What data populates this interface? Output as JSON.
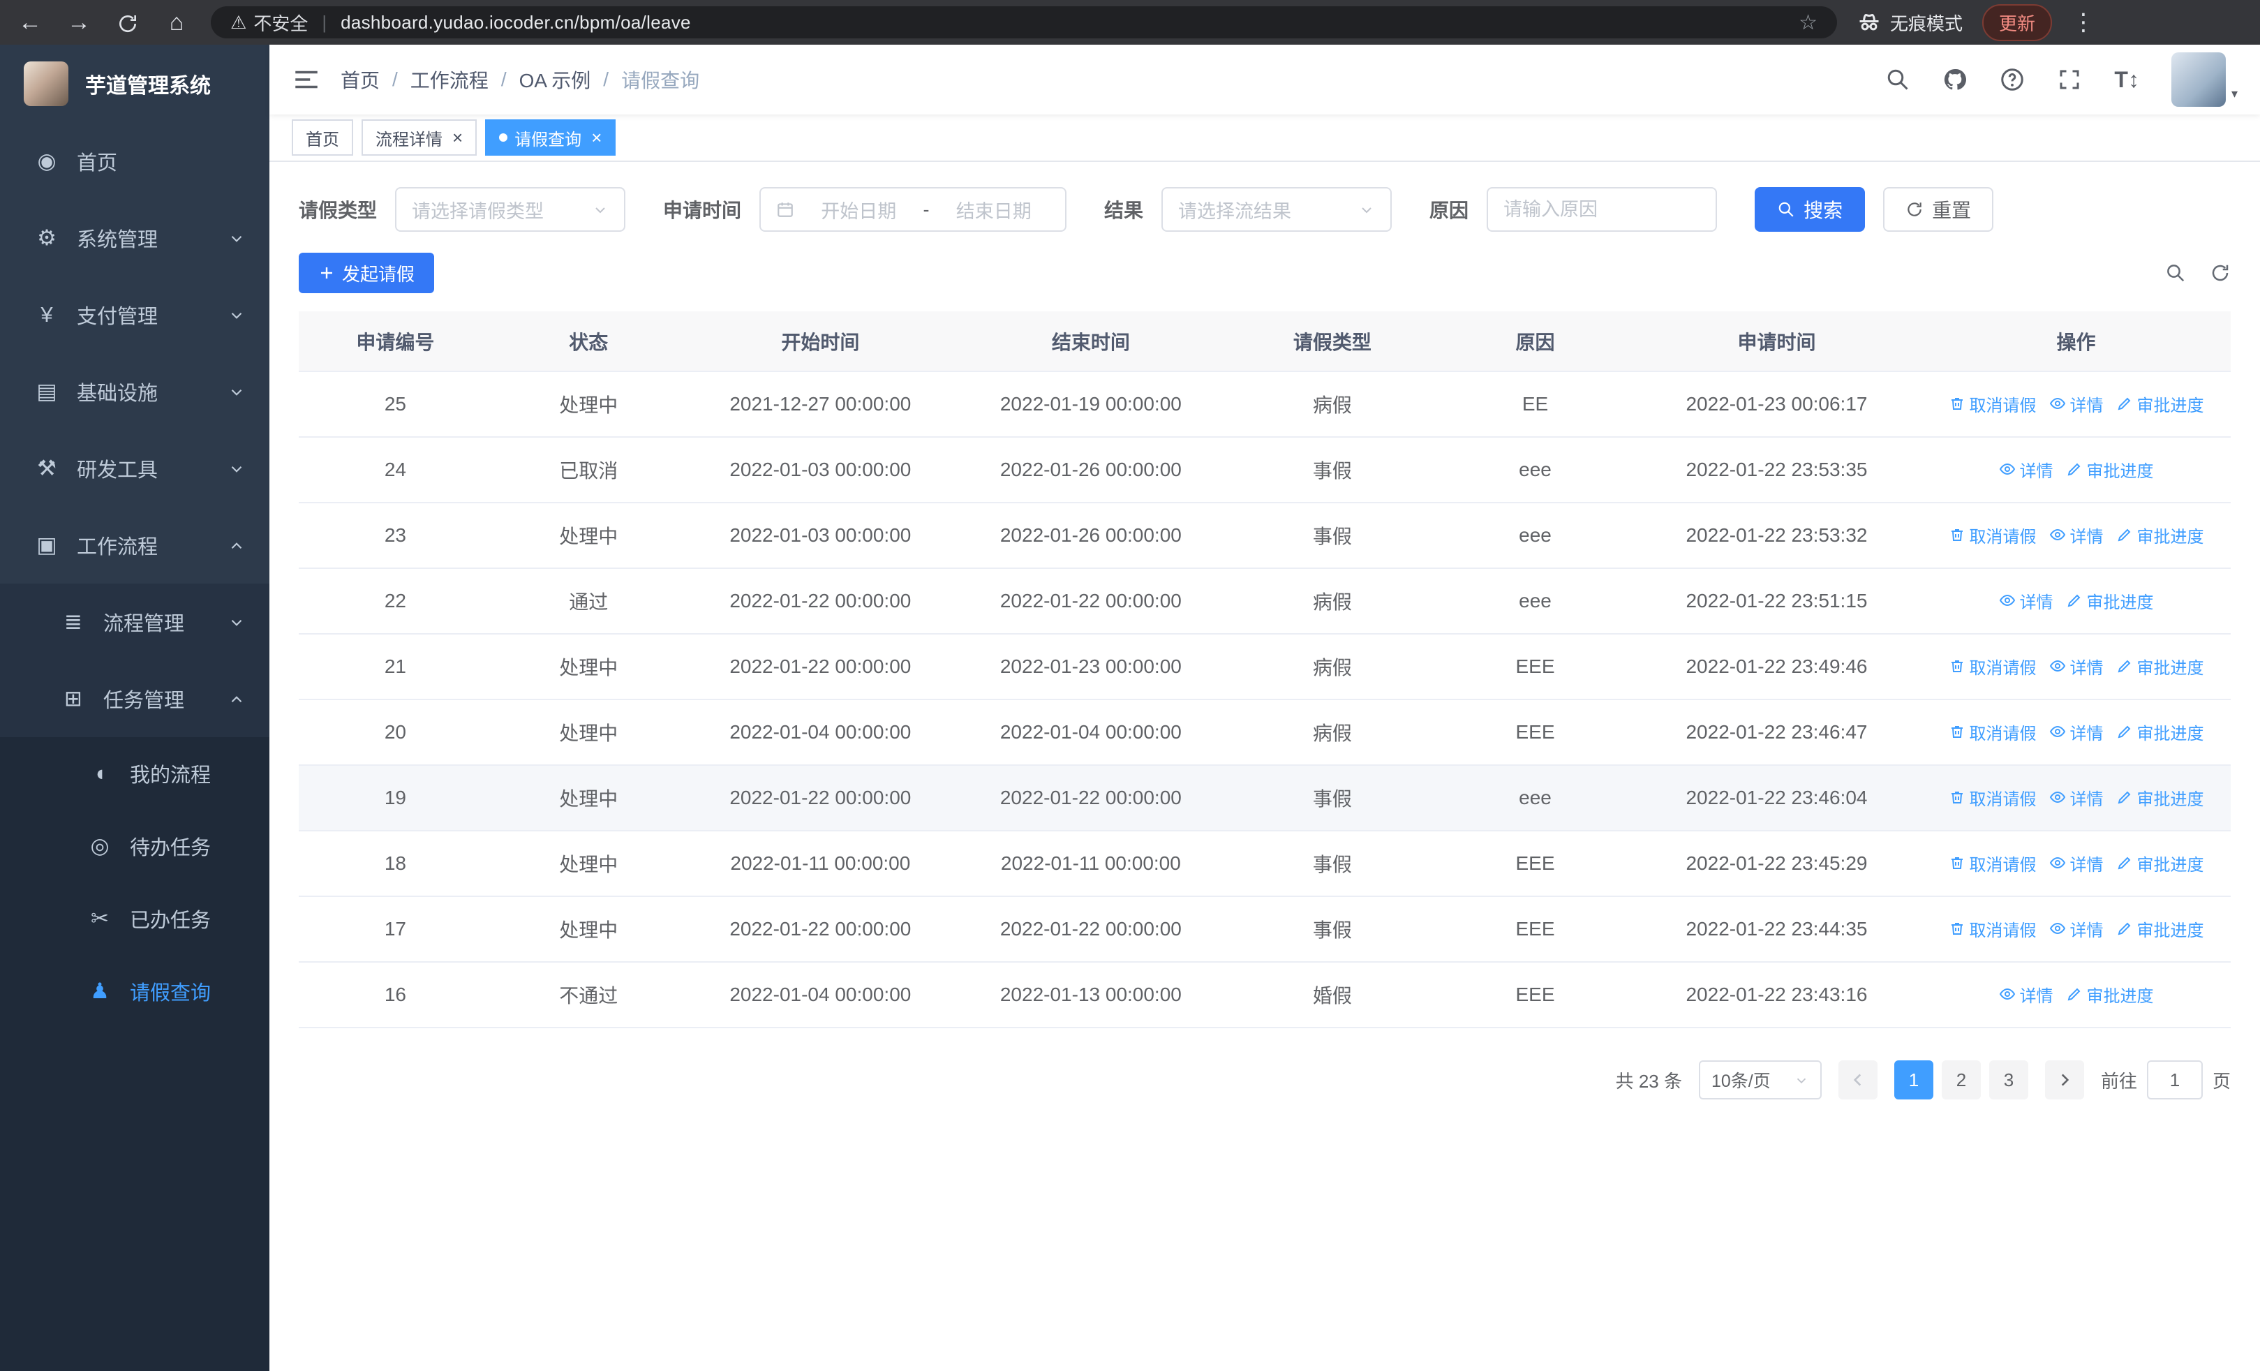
{
  "browser": {
    "warning": "不安全",
    "url": "dashboard.yudao.iocoder.cn/bpm/oa/leave",
    "incognito_label": "无痕模式",
    "update_label": "更新"
  },
  "sidebar": {
    "logo_title": "芋道管理系统",
    "items": [
      {
        "key": "home",
        "label": "首页",
        "icon": "dashboard-icon",
        "level": 1,
        "chevron": null,
        "active": false
      },
      {
        "key": "system-mgmt",
        "label": "系统管理",
        "icon": "gear-icon",
        "level": 1,
        "chevron": "down",
        "active": false
      },
      {
        "key": "payment-mgmt",
        "label": "支付管理",
        "icon": "yen-icon",
        "level": 1,
        "chevron": "down",
        "active": false
      },
      {
        "key": "infrastructure",
        "label": "基础设施",
        "icon": "infra-icon",
        "level": 1,
        "chevron": "down",
        "active": false
      },
      {
        "key": "dev-tools",
        "label": "研发工具",
        "icon": "tools-icon",
        "level": 1,
        "chevron": "down",
        "active": false
      },
      {
        "key": "workflow",
        "label": "工作流程",
        "icon": "workflow-icon",
        "level": 1,
        "chevron": "up",
        "active": false
      },
      {
        "key": "process-mgmt",
        "label": "流程管理",
        "icon": "process-icon",
        "level": 2,
        "chevron": "down",
        "active": false
      },
      {
        "key": "task-mgmt",
        "label": "任务管理",
        "icon": "task-icon",
        "level": 2,
        "chevron": "up",
        "active": false
      },
      {
        "key": "my-process",
        "label": "我的流程",
        "icon": "chat-icon",
        "level": 3,
        "chevron": null,
        "active": false
      },
      {
        "key": "todo-tasks",
        "label": "待办任务",
        "icon": "eye-icon",
        "level": 3,
        "chevron": null,
        "active": false
      },
      {
        "key": "done-tasks",
        "label": "已办任务",
        "icon": "done-icon",
        "level": 3,
        "chevron": null,
        "active": false
      },
      {
        "key": "leave-query",
        "label": "请假查询",
        "icon": "user-icon",
        "level": 3,
        "chevron": null,
        "active": true
      }
    ]
  },
  "header": {
    "breadcrumbs": [
      "首页",
      "工作流程",
      "OA 示例",
      "请假查询"
    ]
  },
  "tabs": [
    {
      "label": "首页",
      "closable": false,
      "active": false
    },
    {
      "label": "流程详情",
      "closable": true,
      "active": false
    },
    {
      "label": "请假查询",
      "closable": true,
      "active": true
    }
  ],
  "filters": {
    "leave_type_label": "请假类型",
    "leave_type_placeholder": "请选择请假类型",
    "apply_time_label": "申请时间",
    "start_date_placeholder": "开始日期",
    "range_separator": "-",
    "end_date_placeholder": "结束日期",
    "result_label": "结果",
    "result_placeholder": "请选择流结果",
    "reason_label": "原因",
    "reason_placeholder": "请输入原因",
    "search_label": "搜索",
    "reset_label": "重置"
  },
  "toolbar": {
    "create_label": "发起请假"
  },
  "table": {
    "columns": [
      "申请编号",
      "状态",
      "开始时间",
      "结束时间",
      "请假类型",
      "原因",
      "申请时间",
      "操作"
    ],
    "action_defs": {
      "cancel": {
        "label": "取消请假",
        "icon": "trash-icon"
      },
      "detail": {
        "label": "详情",
        "icon": "eye-icon"
      },
      "progress": {
        "label": "审批进度",
        "icon": "edit-icon"
      }
    },
    "rows": [
      {
        "id": "25",
        "status": "处理中",
        "start": "2021-12-27 00:00:00",
        "end": "2022-01-19 00:00:00",
        "type": "病假",
        "reason": "EE",
        "apply_time": "2022-01-23 00:06:17",
        "actions": [
          "cancel",
          "detail",
          "progress"
        ],
        "highlighted": false
      },
      {
        "id": "24",
        "status": "已取消",
        "start": "2022-01-03 00:00:00",
        "end": "2022-01-26 00:00:00",
        "type": "事假",
        "reason": "eee",
        "apply_time": "2022-01-22 23:53:35",
        "actions": [
          "detail",
          "progress"
        ],
        "highlighted": false
      },
      {
        "id": "23",
        "status": "处理中",
        "start": "2022-01-03 00:00:00",
        "end": "2022-01-26 00:00:00",
        "type": "事假",
        "reason": "eee",
        "apply_time": "2022-01-22 23:53:32",
        "actions": [
          "cancel",
          "detail",
          "progress"
        ],
        "highlighted": false
      },
      {
        "id": "22",
        "status": "通过",
        "start": "2022-01-22 00:00:00",
        "end": "2022-01-22 00:00:00",
        "type": "病假",
        "reason": "eee",
        "apply_time": "2022-01-22 23:51:15",
        "actions": [
          "detail",
          "progress"
        ],
        "highlighted": false
      },
      {
        "id": "21",
        "status": "处理中",
        "start": "2022-01-22 00:00:00",
        "end": "2022-01-23 00:00:00",
        "type": "病假",
        "reason": "EEE",
        "apply_time": "2022-01-22 23:49:46",
        "actions": [
          "cancel",
          "detail",
          "progress"
        ],
        "highlighted": false
      },
      {
        "id": "20",
        "status": "处理中",
        "start": "2022-01-04 00:00:00",
        "end": "2022-01-04 00:00:00",
        "type": "病假",
        "reason": "EEE",
        "apply_time": "2022-01-22 23:46:47",
        "actions": [
          "cancel",
          "detail",
          "progress"
        ],
        "highlighted": false
      },
      {
        "id": "19",
        "status": "处理中",
        "start": "2022-01-22 00:00:00",
        "end": "2022-01-22 00:00:00",
        "type": "事假",
        "reason": "eee",
        "apply_time": "2022-01-22 23:46:04",
        "actions": [
          "cancel",
          "detail",
          "progress"
        ],
        "highlighted": true
      },
      {
        "id": "18",
        "status": "处理中",
        "start": "2022-01-11 00:00:00",
        "end": "2022-01-11 00:00:00",
        "type": "事假",
        "reason": "EEE",
        "apply_time": "2022-01-22 23:45:29",
        "actions": [
          "cancel",
          "detail",
          "progress"
        ],
        "highlighted": false
      },
      {
        "id": "17",
        "status": "处理中",
        "start": "2022-01-22 00:00:00",
        "end": "2022-01-22 00:00:00",
        "type": "事假",
        "reason": "EEE",
        "apply_time": "2022-01-22 23:44:35",
        "actions": [
          "cancel",
          "detail",
          "progress"
        ],
        "highlighted": false
      },
      {
        "id": "16",
        "status": "不通过",
        "start": "2022-01-04 00:00:00",
        "end": "2022-01-13 00:00:00",
        "type": "婚假",
        "reason": "EEE",
        "apply_time": "2022-01-22 23:43:16",
        "actions": [
          "detail",
          "progress"
        ],
        "highlighted": false
      }
    ]
  },
  "pagination": {
    "total_label": "共 23 条",
    "page_size": "10条/页",
    "pages": [
      "1",
      "2",
      "3"
    ],
    "active_page": "1",
    "goto_label": "前往",
    "goto_value": "1",
    "page_label": "页"
  },
  "colors": {
    "primary_button": "#3478f6",
    "link_blue": "#409eff",
    "sidebar_bg": "#2d3a4b",
    "active_menu": "#409eff"
  }
}
